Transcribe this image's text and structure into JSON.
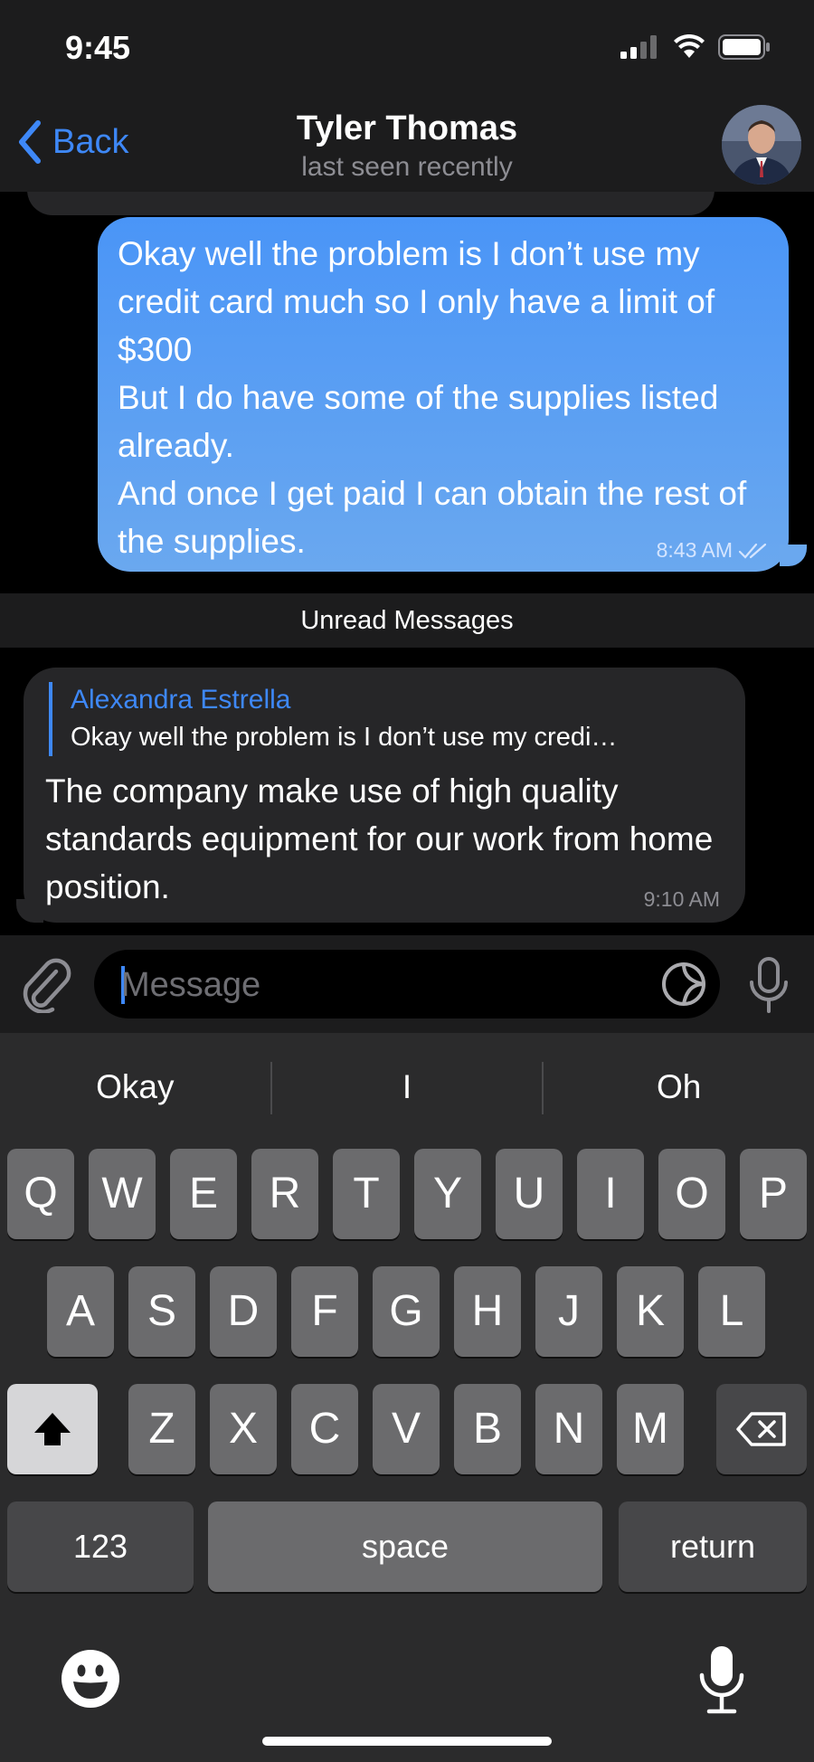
{
  "status_bar": {
    "time": "9:45"
  },
  "nav": {
    "back_label": "Back",
    "title": "Tyler Thomas",
    "subtitle": "last seen recently"
  },
  "messages": {
    "outgoing": {
      "text": "Okay well the problem is I don’t use my credit card much so I only have a limit of $300\nBut I do have some of the supplies listed already.\nAnd once I get paid I can obtain the rest of the supplies.",
      "time": "8:43 AM"
    },
    "unread_label": "Unread Messages",
    "incoming": {
      "reply_name": "Alexandra Estrella",
      "reply_text": "Okay well the problem is I don’t use my credi…",
      "text": "The company make use of high quality standards equipment for our work from home position.",
      "time": "9:10 AM"
    }
  },
  "input": {
    "placeholder": "Message"
  },
  "keyboard": {
    "suggestions": [
      "Okay",
      "I",
      "Oh"
    ],
    "row1": [
      "Q",
      "W",
      "E",
      "R",
      "T",
      "Y",
      "U",
      "I",
      "O",
      "P"
    ],
    "row2": [
      "A",
      "S",
      "D",
      "F",
      "G",
      "H",
      "J",
      "K",
      "L"
    ],
    "row3": [
      "Z",
      "X",
      "C",
      "V",
      "B",
      "N",
      "M"
    ],
    "numbers_label": "123",
    "space_label": "space",
    "return_label": "return"
  },
  "colors": {
    "accent": "#3e88f7",
    "bubble_out": "#5a9ef5",
    "bubble_in": "#262628"
  }
}
